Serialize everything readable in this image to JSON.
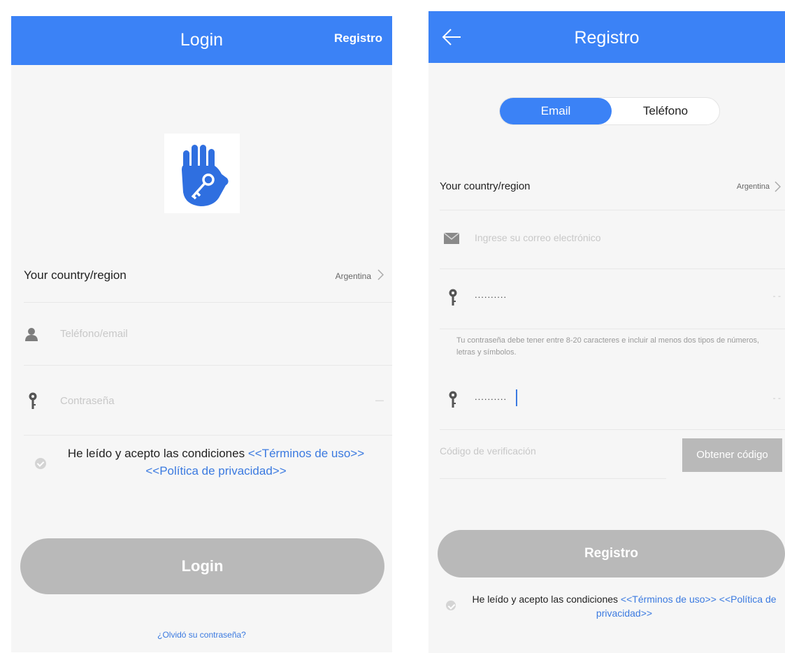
{
  "login": {
    "title": "Login",
    "register_link": "Registro",
    "country_label": "Your country/region",
    "country_value": "Argentina",
    "user_placeholder": "Teléfono/email",
    "password_placeholder": "Contraseña",
    "eye_mark": "—",
    "terms_text": "He leído y acepto las condiciones",
    "terms_link1": "<<Términos de uso>>",
    "terms_link2": "<<Política de privacidad>>",
    "login_button": "Login",
    "forgot_link": "¿Olvidó su contraseña?"
  },
  "register": {
    "title": "Registro",
    "tab_email": "Email",
    "tab_phone": "Teléfono",
    "country_label": "Your country/region",
    "country_value": "Argentina",
    "email_placeholder": "Ingrese su correo electrónico",
    "password_dots": "..........",
    "password_hint": "Tu contraseña debe tener entre 8-20 caracteres e incluir al menos dos tipos de números, letras y símbolos.",
    "confirm_dots": "..........",
    "eye_mark": "- -",
    "code_placeholder": "Código de verificación",
    "get_code_button": "Obtener código",
    "register_button": "Registro",
    "terms_text": "He leído y acepto las condiciones",
    "terms_link1": "<<Términos de uso>>",
    "terms_link2": "<<Política de privacidad>>"
  },
  "icons": {
    "logo": "hand-key-icon",
    "back": "arrow-left-icon",
    "user": "user-icon",
    "key": "key-icon",
    "mail": "mail-icon",
    "chevron": "chevron-right-icon",
    "check": "check-circle-icon"
  },
  "colors": {
    "primary": "#3b82f6",
    "link": "#3b7ae0",
    "disabled_button": "#b9b9b9",
    "background": "#f6f6f6"
  }
}
